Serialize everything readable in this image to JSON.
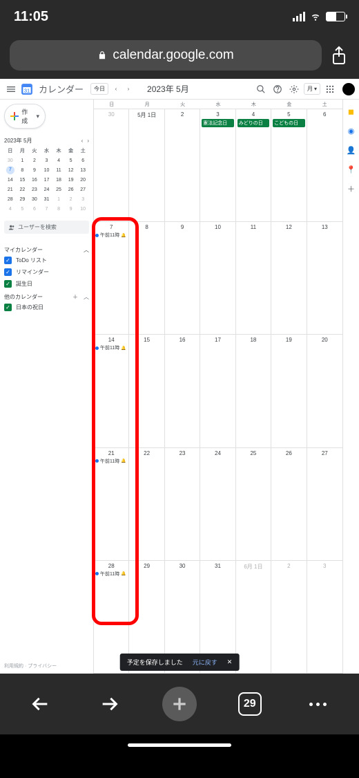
{
  "status": {
    "time": "11:05"
  },
  "safari": {
    "url": "calendar.google.com",
    "tab_count": "29"
  },
  "header": {
    "app_name": "カレンダー",
    "today_label": "今日",
    "date_title": "2023年 5月",
    "view_label": "月"
  },
  "create_label": "作成",
  "mini": {
    "title": "2023年 5月",
    "dows": [
      "日",
      "月",
      "火",
      "水",
      "木",
      "金",
      "土"
    ],
    "rows": [
      [
        {
          "n": "30",
          "dim": true
        },
        {
          "n": "1"
        },
        {
          "n": "2"
        },
        {
          "n": "3"
        },
        {
          "n": "4"
        },
        {
          "n": "5"
        },
        {
          "n": "6"
        }
      ],
      [
        {
          "n": "7",
          "sel": true
        },
        {
          "n": "8"
        },
        {
          "n": "9"
        },
        {
          "n": "10"
        },
        {
          "n": "11"
        },
        {
          "n": "12"
        },
        {
          "n": "13"
        }
      ],
      [
        {
          "n": "14"
        },
        {
          "n": "15"
        },
        {
          "n": "16"
        },
        {
          "n": "17"
        },
        {
          "n": "18"
        },
        {
          "n": "19"
        },
        {
          "n": "20"
        }
      ],
      [
        {
          "n": "21"
        },
        {
          "n": "22"
        },
        {
          "n": "23"
        },
        {
          "n": "24"
        },
        {
          "n": "25"
        },
        {
          "n": "26"
        },
        {
          "n": "27"
        }
      ],
      [
        {
          "n": "28"
        },
        {
          "n": "29"
        },
        {
          "n": "30"
        },
        {
          "n": "31"
        },
        {
          "n": "1",
          "dim": true
        },
        {
          "n": "2",
          "dim": true
        },
        {
          "n": "3",
          "dim": true
        }
      ],
      [
        {
          "n": "4",
          "dim": true
        },
        {
          "n": "5",
          "dim": true
        },
        {
          "n": "6",
          "dim": true
        },
        {
          "n": "7",
          "dim": true
        },
        {
          "n": "8",
          "dim": true
        },
        {
          "n": "9",
          "dim": true
        },
        {
          "n": "10",
          "dim": true
        }
      ]
    ]
  },
  "search_people": "ユーザーを検索",
  "mycal_label": "マイカレンダー",
  "mycals": [
    {
      "label": "ToDo リスト",
      "color": "#1a73e8"
    },
    {
      "label": "リマインダー",
      "color": "#1a73e8"
    },
    {
      "label": "誕生日",
      "color": "#0b8043"
    }
  ],
  "othercal_label": "他のカレンダー",
  "othercals": [
    {
      "label": "日本の祝日",
      "color": "#0b8043"
    }
  ],
  "footer": "利用規約 · プライバシー",
  "grid": {
    "dows": [
      "日",
      "月",
      "火",
      "水",
      "木",
      "金",
      "土"
    ],
    "weeks": [
      [
        {
          "label": "30",
          "dim": true
        },
        {
          "label": "5月 1日"
        },
        {
          "label": "2"
        },
        {
          "label": "3",
          "holiday": "憲法記念日"
        },
        {
          "label": "4",
          "holiday": "みどりの日"
        },
        {
          "label": "5",
          "holiday": "こどもの日"
        },
        {
          "label": "6"
        }
      ],
      [
        {
          "label": "7",
          "event": "午前11時"
        },
        {
          "label": "8"
        },
        {
          "label": "9"
        },
        {
          "label": "10"
        },
        {
          "label": "11"
        },
        {
          "label": "12"
        },
        {
          "label": "13"
        }
      ],
      [
        {
          "label": "14",
          "event": "午前11時"
        },
        {
          "label": "15"
        },
        {
          "label": "16"
        },
        {
          "label": "17"
        },
        {
          "label": "18"
        },
        {
          "label": "19"
        },
        {
          "label": "20"
        }
      ],
      [
        {
          "label": "21",
          "event": "午前11時"
        },
        {
          "label": "22"
        },
        {
          "label": "23"
        },
        {
          "label": "24"
        },
        {
          "label": "25"
        },
        {
          "label": "26"
        },
        {
          "label": "27"
        }
      ],
      [
        {
          "label": "28",
          "event": "午前11時"
        },
        {
          "label": "29"
        },
        {
          "label": "30"
        },
        {
          "label": "31"
        },
        {
          "label": "6月 1日",
          "dim": true
        },
        {
          "label": "2",
          "dim": true
        },
        {
          "label": "3",
          "dim": true
        }
      ]
    ]
  },
  "toast": {
    "msg": "予定を保存しました",
    "undo": "元に戻す"
  },
  "rail_icons": [
    "keep-icon",
    "tasks-icon",
    "contacts-icon",
    "maps-icon",
    "add-icon"
  ]
}
